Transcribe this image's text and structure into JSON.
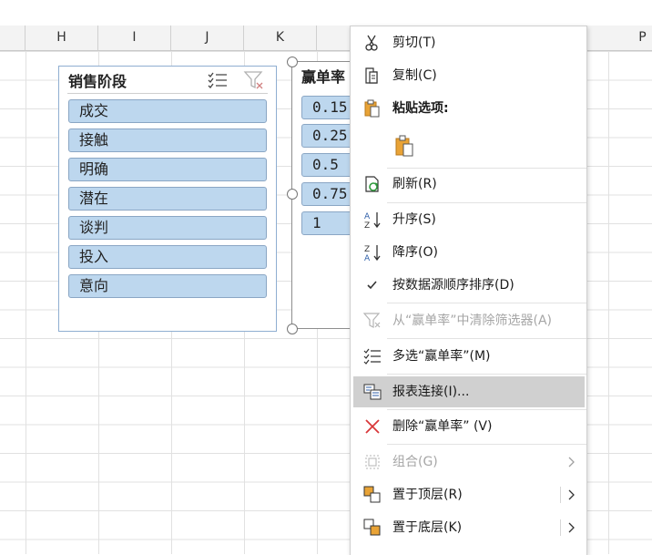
{
  "columns": [
    {
      "label": "H"
    },
    {
      "label": "I"
    },
    {
      "label": "J"
    },
    {
      "label": "K"
    },
    {
      "label": "P"
    }
  ],
  "slicer_stage": {
    "title": "销售阶段",
    "items": [
      "成交",
      "接触",
      "明确",
      "潜在",
      "谈判",
      "投入",
      "意向"
    ]
  },
  "slicer_winrate": {
    "title": "赢单率",
    "items": [
      "0.15",
      "0.25",
      "0.5",
      "0.75",
      "1"
    ]
  },
  "menu": {
    "cut": "剪切(T)",
    "copy": "复制(C)",
    "paste_options": "粘贴选项:",
    "refresh": "刷新(R)",
    "sort_asc": "升序(S)",
    "sort_desc": "降序(O)",
    "sort_source": "按数据源顺序排序(D)",
    "clear_filter": "从“赢单率”中清除筛选器(A)",
    "multi_select": "多选“赢单率”(M)",
    "report_connections": "报表连接(I)...",
    "delete": "删除“赢单率” (V)",
    "group": "组合(G)",
    "bring_front": "置于顶层(R)",
    "send_back": "置于底层(K)"
  }
}
